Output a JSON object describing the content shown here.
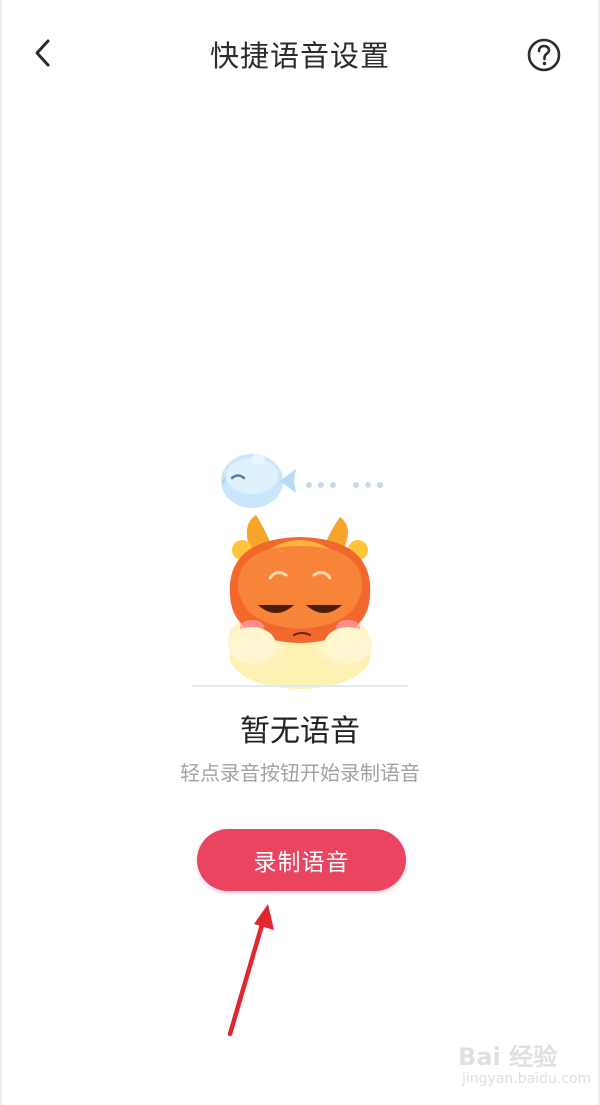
{
  "header": {
    "title": "快捷语音设置",
    "back_icon": "chevron-left-icon",
    "help_icon": "question-circle-icon"
  },
  "empty_state": {
    "title": "暂无语音",
    "subtitle": "轻点录音按钮开始录制语音"
  },
  "record_button": {
    "label": "录制语音",
    "color": "#e94560"
  },
  "annotation": {
    "arrow_color": "#e0262f"
  },
  "watermark": {
    "brand": "Bai 经验",
    "url": "jingyan.baidu.com"
  }
}
